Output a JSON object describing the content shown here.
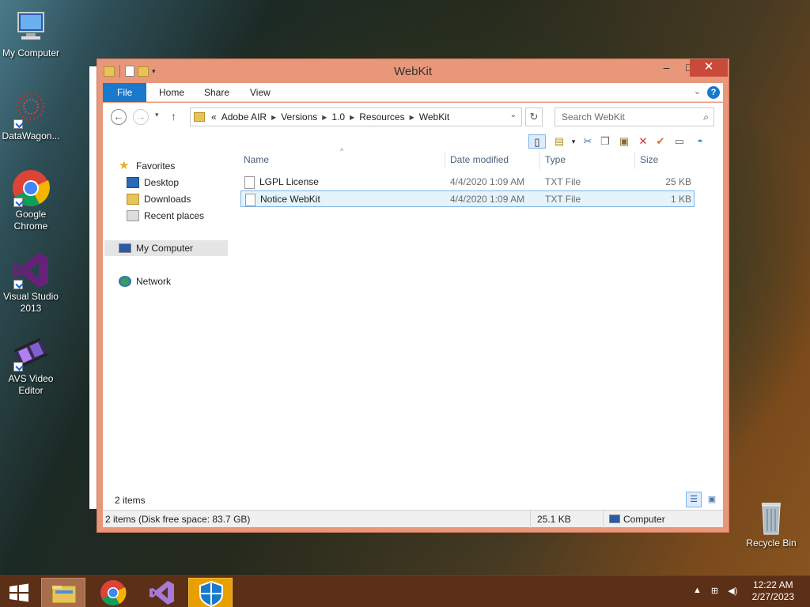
{
  "desktop": {
    "icons": [
      {
        "label": "My Computer"
      },
      {
        "label": "DataWagon..."
      },
      {
        "label": "Google Chrome"
      },
      {
        "label": "Visual Studio 2013"
      },
      {
        "label": "AVS Video Editor"
      },
      {
        "label": "Recycle Bin"
      }
    ]
  },
  "window": {
    "title": "WebKit",
    "controls": {
      "minimize": "–",
      "maximize": "□",
      "close": "✕"
    },
    "ribbon_tabs": [
      "File",
      "Home",
      "Share",
      "View"
    ],
    "help": "?",
    "address": {
      "prefix": "«",
      "crumbs": [
        "Adobe AIR",
        "Versions",
        "1.0",
        "Resources",
        "WebKit"
      ]
    },
    "search": {
      "placeholder": "Search WebKit"
    },
    "nav_pane": {
      "favorites_label": "Favorites",
      "favorites": [
        "Desktop",
        "Downloads",
        "Recent places"
      ],
      "computer_label": "My Computer",
      "network_label": "Network"
    },
    "columns": {
      "name": "Name",
      "date": "Date modified",
      "type": "Type",
      "size": "Size"
    },
    "files": [
      {
        "name": "LGPL License",
        "date": "4/4/2020 1:09 AM",
        "type": "TXT File",
        "size": "25 KB"
      },
      {
        "name": "Notice WebKit",
        "date": "4/4/2020 1:09 AM",
        "type": "TXT File",
        "size": "1 KB"
      }
    ],
    "item_count": "2 items",
    "status": {
      "left": "2 items (Disk free space: 83.7 GB)",
      "size": "25.1 KB",
      "location": "Computer"
    }
  },
  "taskbar": {
    "time": "12:22 AM",
    "date": "2/27/2023"
  },
  "colors": {
    "window_frame": "#e8977a",
    "close_button": "#c94a3a",
    "file_tab": "#1979ca",
    "taskbar": "#5c2f17",
    "selection": "#e5f3fb"
  }
}
